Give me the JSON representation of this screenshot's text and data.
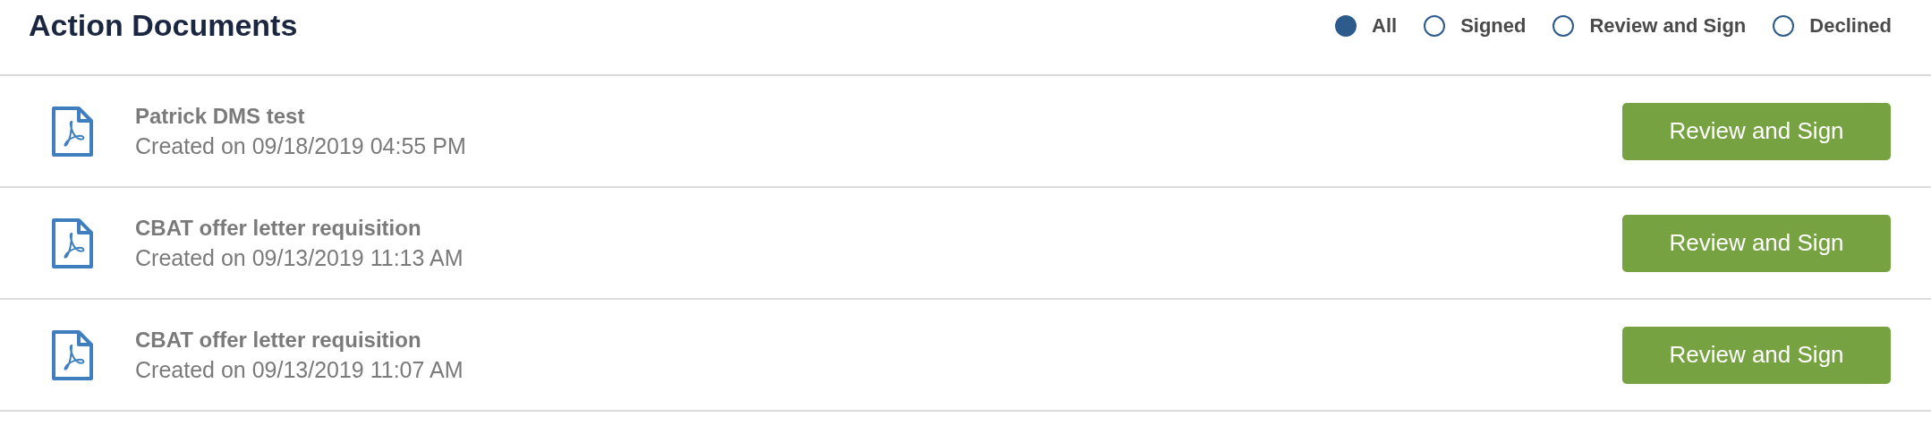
{
  "title": "Action Documents",
  "filters": [
    {
      "label": "All",
      "selected": true
    },
    {
      "label": "Signed",
      "selected": false
    },
    {
      "label": "Review and Sign",
      "selected": false
    },
    {
      "label": "Declined",
      "selected": false
    }
  ],
  "documents": [
    {
      "name": "Patrick DMS test",
      "created": "Created on 09/18/2019 04:55 PM",
      "action": "Review and Sign"
    },
    {
      "name": "CBAT offer letter requisition",
      "created": "Created on 09/13/2019 11:13 AM",
      "action": "Review and Sign"
    },
    {
      "name": "CBAT offer letter requisition",
      "created": "Created on 09/13/2019 11:07 AM",
      "action": "Review and Sign"
    }
  ]
}
